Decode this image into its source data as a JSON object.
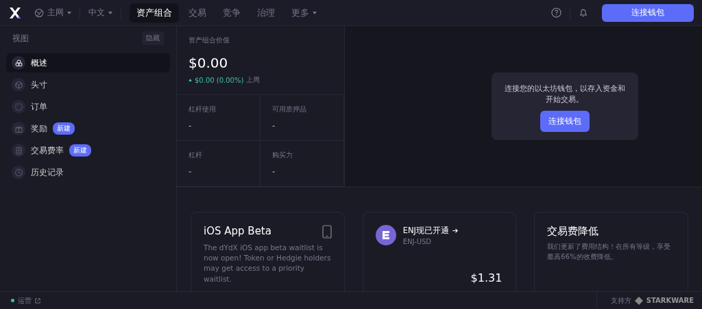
{
  "nav": {
    "network": "主网",
    "language": "中文",
    "tabs": [
      {
        "label": "资产组合",
        "selected": true,
        "dropdown": false
      },
      {
        "label": "交易",
        "selected": false,
        "dropdown": false
      },
      {
        "label": "竞争",
        "selected": false,
        "dropdown": false
      },
      {
        "label": "治理",
        "selected": false,
        "dropdown": false
      },
      {
        "label": "更多",
        "selected": false,
        "dropdown": true
      }
    ],
    "connect_button": "连接钱包"
  },
  "sidebar": {
    "title": "视图",
    "hide_button": "隐藏",
    "items": [
      {
        "label": "概述",
        "selected": true
      },
      {
        "label": "头寸",
        "selected": false
      },
      {
        "label": "订单",
        "selected": false
      },
      {
        "label": "奖励",
        "selected": false,
        "badge": "新建"
      },
      {
        "label": "交易费率",
        "selected": false,
        "badge": "新建"
      },
      {
        "label": "历史记录",
        "selected": false
      }
    ]
  },
  "portfolio": {
    "label": "资产组合价值",
    "value": "$0.00",
    "change": "$0.00 (0.00%)",
    "period": "上周",
    "stats": [
      {
        "label": "杠杆使用",
        "value": "-"
      },
      {
        "label": "可用质押品",
        "value": "-"
      },
      {
        "label": "杠杆",
        "value": "-"
      },
      {
        "label": "购买力",
        "value": "-"
      }
    ]
  },
  "connect_prompt": {
    "message": "连接您的以太坊钱包，以存入资金和开始交易。",
    "button": "连接钱包"
  },
  "cards": [
    {
      "kind": "promo",
      "title": "iOS App Beta",
      "body": "The dYdX iOS app beta waitlist is now open! Token or Hedgie holders may get access to a priority waitlist."
    },
    {
      "kind": "market",
      "title": "ENJ现已开通",
      "subtitle": "ENJ-USD",
      "price": "$1.31"
    },
    {
      "kind": "text",
      "title": "交易费降低",
      "body": "我们更新了费用结构！在所有等级，享受最高66%的收费降低。"
    }
  ],
  "footer": {
    "status": "运营",
    "supported_by": "支持方",
    "brand": "STARKWARE"
  }
}
